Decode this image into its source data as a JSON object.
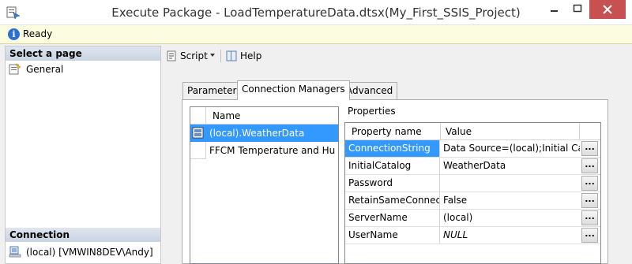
{
  "window": {
    "title": "Execute Package - LoadTemperatureData.dtsx(My_First_SSIS_Project)",
    "minimize_icon": "minimize-icon",
    "maximize_icon": "maximize-icon",
    "close_icon": "close-icon"
  },
  "status": {
    "text": "Ready",
    "icon": "info-icon"
  },
  "left_pane": {
    "select_page_header": "Select a page",
    "pages": [
      {
        "label": "General",
        "icon": "page-icon"
      }
    ],
    "connection_header": "Connection",
    "connection": {
      "label": "(local) [VMWIN8DEV\\Andy]",
      "icon": "server-icon"
    }
  },
  "toolbar": {
    "script_label": "Script",
    "help_label": "Help"
  },
  "tabs": [
    {
      "label": "Parameters",
      "selected": false
    },
    {
      "label": "Connection Managers",
      "selected": true
    },
    {
      "label": "Advanced",
      "selected": false
    }
  ],
  "connection_list": {
    "column_header": "Name",
    "rows": [
      {
        "label": "(local).WeatherData",
        "selected": true
      },
      {
        "label": "FFCM Temperature and Hu...",
        "selected": false
      }
    ]
  },
  "properties": {
    "label": "Properties",
    "col_name": "Property name",
    "col_value": "Value",
    "button_label": "...",
    "rows": [
      {
        "name": "ConnectionString",
        "value": "Data Source=(local);Initial Cat...",
        "active": true
      },
      {
        "name": "InitialCatalog",
        "value": "WeatherData"
      },
      {
        "name": "Password",
        "value": ""
      },
      {
        "name": "RetainSameConnec...",
        "value": "False"
      },
      {
        "name": "ServerName",
        "value": "(local)"
      },
      {
        "name": "UserName",
        "value": "NULL"
      }
    ]
  },
  "colors": {
    "selection": "#3399ff",
    "close_button": "#c75050",
    "status_background": "#fcfce0"
  }
}
